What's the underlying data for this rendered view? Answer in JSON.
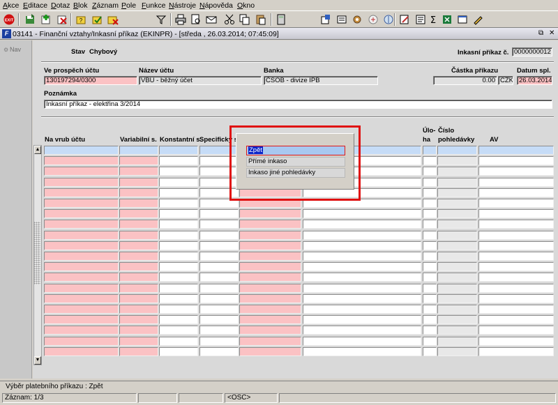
{
  "menu": [
    "Akce",
    "Editace",
    "Dotaz",
    "Blok",
    "Záznam",
    "Pole",
    "Funkce",
    "Nástroje",
    "Nápověda",
    "Okno"
  ],
  "toolbar": {
    "exit_label": "EXIT",
    "icons": [
      "exit-icon",
      "save-icon",
      "insert-record-icon",
      "delete-record-icon",
      "enter-query-icon",
      "execute-query-icon",
      "cancel-query-icon",
      "filter-icon",
      "cut-icon",
      "copy-icon",
      "paste-icon",
      "print-icon",
      "print-preview-icon",
      "email-icon",
      "calculator-icon",
      "export-icon",
      "world-icon",
      "settings-icon",
      "note-icon",
      "list-icon",
      "sum-icon",
      "excel-icon",
      "edit-icon",
      "help-icon"
    ]
  },
  "window": {
    "title": "03141 - Finanční vztahy/Inkasní příkaz (EKINPR) - [středa , 26.03.2014; 07:45:09]",
    "restore_glyph": "⧉",
    "close_glyph": "✕"
  },
  "nav": {
    "label": "Nav"
  },
  "header": {
    "stav_label": "Stav",
    "stav_value": "Chybový",
    "inkasni_label": "Inkasní příkaz č.",
    "inkasni_value": "0000000012"
  },
  "account": {
    "ucet_label": "Ve prospěch účtu",
    "ucet_value": "130197294/0300",
    "nazev_label": "Název účtu",
    "nazev_value": "VBU - běžný účet",
    "banka_label": "Banka",
    "banka_value": "ČSOB - divize IPB",
    "castka_label": "Částka příkazu",
    "castka_value": "0.00",
    "mena_value": "CZK",
    "datum_label": "Datum spl.",
    "datum_value": "26.03.2014"
  },
  "note": {
    "label": "Poznámka",
    "value": "Inkasní příkaz - elektřina 3/2014"
  },
  "grid": {
    "headers": {
      "vrub": "Na vrub účtu",
      "variabilni": "Variabilní s.",
      "konstantni": "Konstantní s.",
      "specificky": "Specifický s.",
      "uloha_1": "Úlo-",
      "uloha_2": "ha",
      "cislo_1": "Číslo",
      "cislo_2": "pohledávky",
      "av": "AV"
    },
    "row_count": 20
  },
  "popup": {
    "items": [
      "Zpět",
      "Přímé inkaso",
      "Inkaso jiné pohledávky"
    ]
  },
  "status": {
    "message": "Výběr platebního příkazu : Zpět",
    "record": "Záznam: 1/3",
    "osc": "<OSC>"
  },
  "colors": {
    "required_field": "#fbc2c4",
    "selected_row": "#c6dcf7",
    "highlight_border": "#e01010"
  }
}
